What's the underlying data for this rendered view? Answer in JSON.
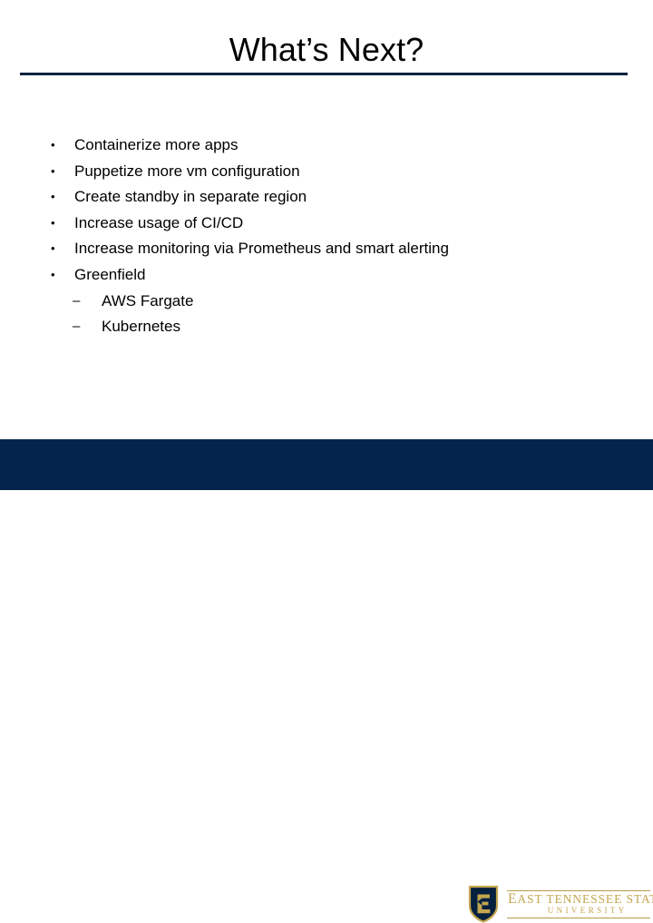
{
  "slide": {
    "title": "What’s Next?",
    "accent_color": "#0c2340",
    "footer_color": "#04244c",
    "gold_color": "#c3a64e",
    "text_color": "#000000",
    "background_color": "#ffffff"
  },
  "bullets": [
    {
      "marker": "•",
      "text": "Containerize more apps",
      "level": 1
    },
    {
      "marker": "•",
      "text": "Puppetize more vm configuration",
      "level": 1
    },
    {
      "marker": "•",
      "text": "Create standby in separate region",
      "level": 1
    },
    {
      "marker": "•",
      "text": "Increase usage of CI/CD",
      "level": 1
    },
    {
      "marker": "•",
      "text": "Increase monitoring via Prometheus and smart alerting",
      "level": 1
    },
    {
      "marker": "•",
      "text": "Greenfield",
      "level": 1
    },
    {
      "marker": "–",
      "text": "AWS Fargate",
      "level": 2
    },
    {
      "marker": "–",
      "text": "Kubernetes",
      "level": 2
    }
  ],
  "footer": {
    "logo": {
      "shield_letter": "E",
      "line1_first": "E",
      "line1_rest": "AST TENNESSEE STATE",
      "line2": "UNIVERSITY"
    }
  }
}
